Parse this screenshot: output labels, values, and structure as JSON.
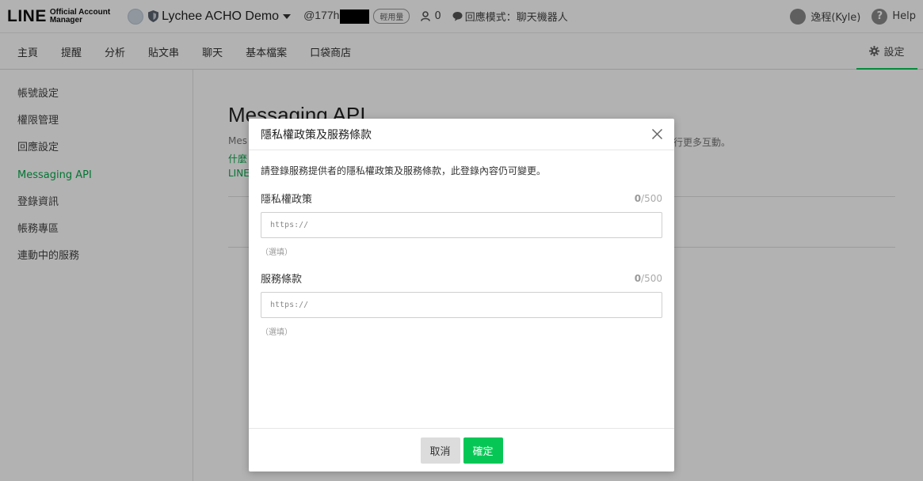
{
  "topbar": {
    "logo_main": "LINE",
    "logo_sub_1": "Official Account",
    "logo_sub_2": "Manager",
    "account_name": "Lychee ACHO Demo",
    "account_id_prefix": "@177h",
    "badge": "輕用量",
    "follower_count": "0",
    "response_mode": "回應模式：聊天機器人",
    "user_name": "逸程(Kyle)",
    "help": "Help"
  },
  "nav": {
    "items": [
      "主頁",
      "提醒",
      "分析",
      "貼文串",
      "聊天",
      "基本檔案",
      "口袋商店"
    ],
    "settings": "設定"
  },
  "sidebar": {
    "items": [
      "帳號設定",
      "權限管理",
      "回應設定",
      "Messaging API",
      "登錄資訊",
      "帳務專區",
      "連動中的服務"
    ],
    "active": "Messaging API"
  },
  "main": {
    "title": "Messaging API",
    "desc_start": "Mes",
    "desc_end": "行更多互動。",
    "link1": "什麼",
    "link2": "LINE"
  },
  "modal": {
    "title": "隱私權政策及服務條款",
    "intro": "請登錄服務提供者的隱私權政策及服務條款，此登錄內容仍可變更。",
    "privacy": {
      "label": "隱私權政策",
      "count": "0",
      "max": "/500",
      "placeholder": "https://",
      "hint": "（選填）"
    },
    "terms": {
      "label": "服務條款",
      "count": "0",
      "max": "/500",
      "placeholder": "https://",
      "hint": "（選填）"
    },
    "cancel": "取消",
    "confirm": "確定"
  },
  "colors": {
    "accent": "#06c755",
    "active_text": "#06a94b"
  }
}
